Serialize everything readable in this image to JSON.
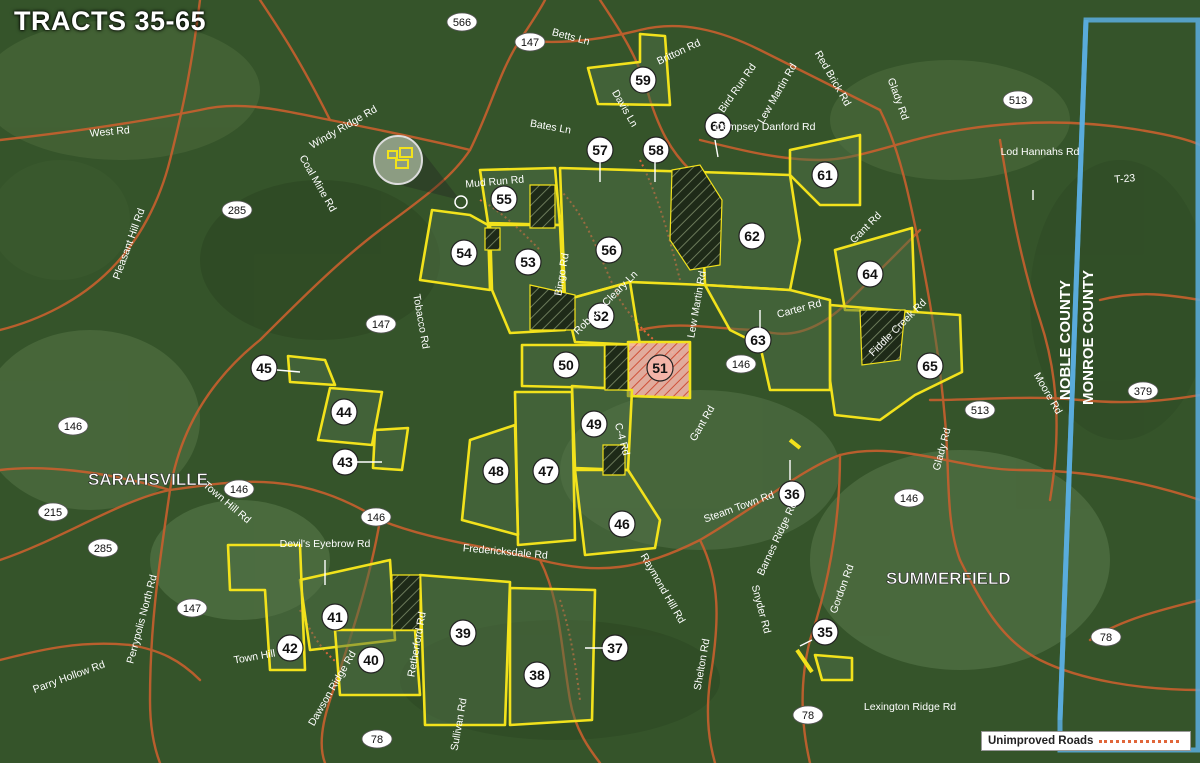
{
  "title": "TRACTS 35-65",
  "legend": {
    "unimproved_roads": "Unimproved Roads",
    "unimproved_color": "#e0663a"
  },
  "colors": {
    "tract_outline": "#f2e21c",
    "road": "#c8602e",
    "county_line": "#5aaee0",
    "forest": "#35542a",
    "highlight_tract": "#f2a79a"
  },
  "towns": {
    "sarahsville": "SARAHSVILLE",
    "summerfield": "SUMMERFIELD"
  },
  "counties": {
    "noble": "NOBLE COUNTY",
    "monroe": "MONROE COUNTY"
  },
  "tracts": [
    "35",
    "36",
    "37",
    "38",
    "39",
    "40",
    "41",
    "42",
    "43",
    "44",
    "45",
    "46",
    "47",
    "48",
    "49",
    "50",
    "51",
    "52",
    "53",
    "54",
    "55",
    "56",
    "57",
    "58",
    "59",
    "60",
    "61",
    "62",
    "63",
    "64",
    "65"
  ],
  "routes": [
    "566",
    "147",
    "285",
    "147",
    "146",
    "215",
    "285",
    "146",
    "146",
    "147",
    "78",
    "146",
    "513",
    "146",
    "513",
    "379",
    "78",
    "78"
  ],
  "roads": [
    "Betts Ln",
    "Britton Rd",
    "West Rd",
    "Windy Ridge Rd",
    "Coal Mine Rd",
    "Pleasant Hill Rd",
    "Bates Ln",
    "Mud Run Rd",
    "Davis Ln",
    "Bird Run Rd",
    "Lew Martin Rd",
    "Red Brick Rd",
    "Dempsey Danford Rd",
    "Glady Rd",
    "Lod Hannahs Rd",
    "T-23",
    "Gant Rd",
    "Tobacco Rd",
    "Bingo Rd",
    "Roberta Cleary Ln",
    "Lew Martin Rd",
    "Carter Rd",
    "Fiddle Creek Rd",
    "C-4 Rd",
    "Gant Rd",
    "Moore Rd",
    "Town Hill Rd",
    "Devil's Eyebrow Rd",
    "Steam Town Rd",
    "Barnes Ridge Rd",
    "Fredericksdale Rd",
    "Raymond Hill Rd",
    "Gordon Rd",
    "Perrypolis North Rd",
    "Town Hill",
    "Dawson Ridge Rd",
    "Retherford Rd",
    "Sullivan Rd",
    "Shelton Rd",
    "Snyder Rd",
    "Parry Hollow Rd",
    "Lexington Ridge Rd",
    "Glady Rd"
  ]
}
